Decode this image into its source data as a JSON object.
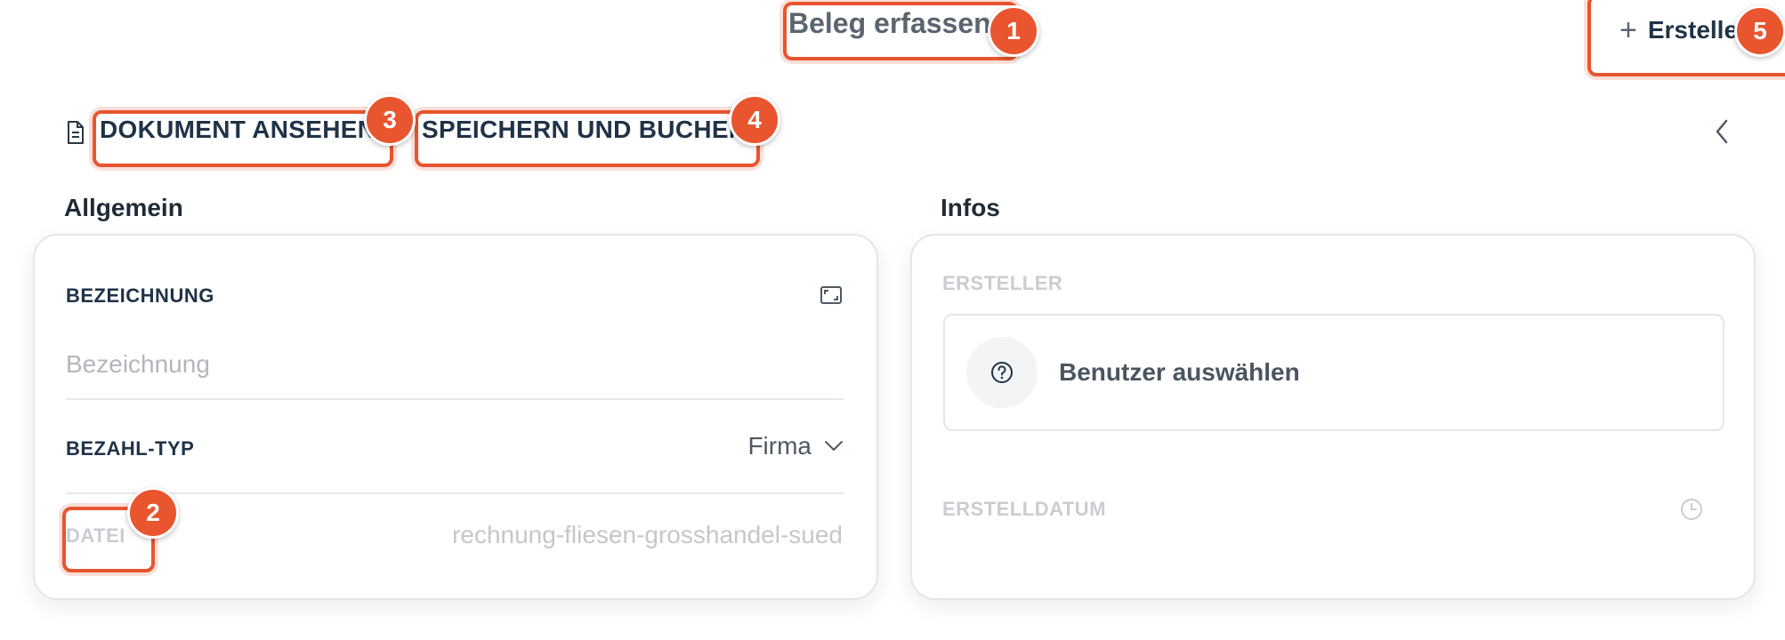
{
  "header": {
    "title": "Beleg erfassen",
    "create_label": "Erstellen"
  },
  "toolbar": {
    "view_document_label": "DOKUMENT ANSEHEN",
    "save_and_book_label": "SPEICHERN UND BUCHEN"
  },
  "general": {
    "section_title": "Allgemein",
    "designation": {
      "label": "BEZEICHNUNG",
      "placeholder": "Bezeichnung",
      "value": ""
    },
    "payment_type": {
      "label": "BEZAHL-TYP",
      "value": "Firma"
    },
    "file": {
      "label": "DATEI",
      "value": "rechnung-fliesen-grosshandel-sued"
    }
  },
  "info": {
    "section_title": "Infos",
    "creator": {
      "label": "ERSTELLER",
      "placeholder": "Benutzer auswählen"
    },
    "created_date": {
      "label": "ERSTELLDATUM"
    }
  },
  "annotations": [
    "1",
    "2",
    "3",
    "4",
    "5"
  ],
  "colors": {
    "accent": "#e8552f",
    "text_primary": "#1f3347",
    "muted": "#c9cdd2",
    "border": "#e3e6ea"
  },
  "icons": [
    "document-icon",
    "plus-icon",
    "chevron-left-icon",
    "expand-icon",
    "chevron-down-icon",
    "help-circle-icon",
    "clock-icon"
  ]
}
